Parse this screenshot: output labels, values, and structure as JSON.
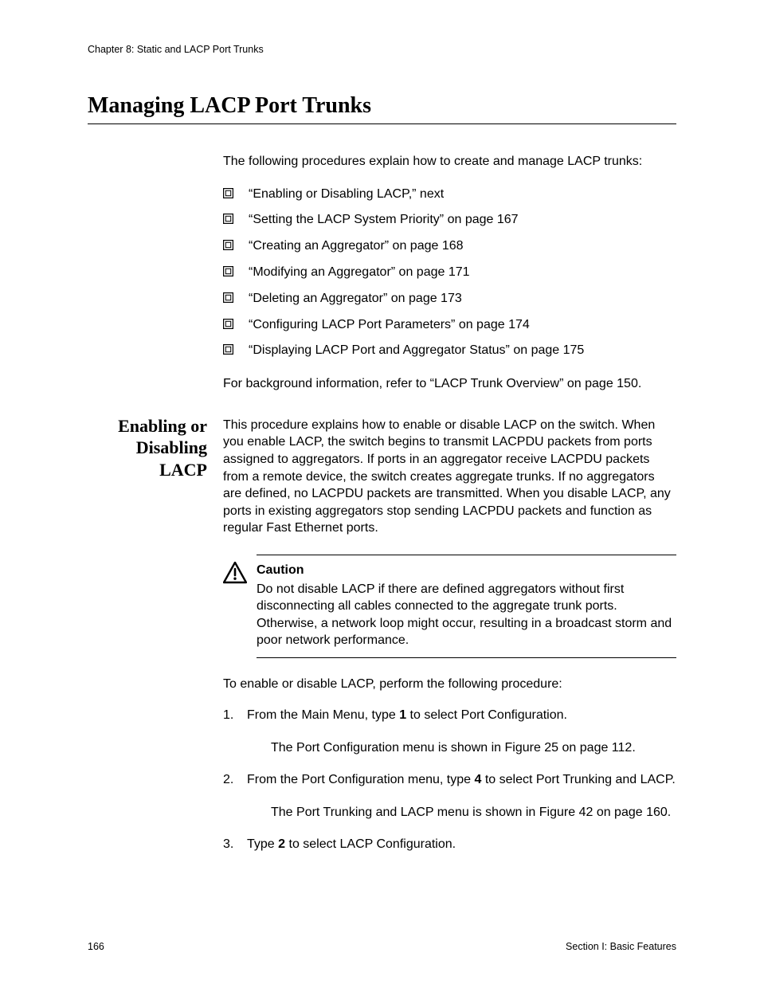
{
  "header": {
    "running": "Chapter 8: Static and LACP Port Trunks"
  },
  "title": "Managing LACP Port Trunks",
  "intro": "The following procedures explain how to create and manage LACP trunks:",
  "bullets": [
    "“Enabling or Disabling LACP,”  next",
    "“Setting the LACP System Priority” on page 167",
    "“Creating an Aggregator” on page 168",
    "“Modifying an Aggregator” on page 171",
    "“Deleting an Aggregator” on page 173",
    "“Configuring LACP Port Parameters” on page 174",
    "“Displaying LACP Port and Aggregator Status” on page 175"
  ],
  "background_ref": "For background information, refer to “LACP Trunk Overview” on page 150.",
  "subsection": {
    "heading_line1": "Enabling or",
    "heading_line2": "Disabling LACP",
    "body": "This procedure explains how to enable or disable LACP on the switch. When you enable LACP, the switch begins to transmit LACPDU packets from ports assigned to aggregators. If ports in an aggregator receive LACPDU packets from a remote device, the switch creates aggregate trunks. If no aggregators are defined, no LACPDU packets are transmitted. When you disable LACP, any ports in existing aggregators stop sending LACPDU packets and function as regular Fast Ethernet ports.",
    "caution": {
      "title": "Caution",
      "text": "Do not disable LACP if there are defined aggregators without first disconnecting all cables connected to the aggregate trunk ports. Otherwise, a network loop might occur, resulting in a broadcast storm and poor network performance."
    },
    "lead": "To enable or disable LACP, perform the following procedure:",
    "steps": [
      {
        "pre": "From the Main Menu, type ",
        "bold": "1",
        "post": " to select Port Configuration.",
        "note": "The Port Configuration menu is shown in Figure 25 on page 112."
      },
      {
        "pre": "From the Port Configuration menu, type ",
        "bold": "4",
        "post": " to select Port Trunking and LACP.",
        "note": "The Port Trunking and LACP menu is shown in Figure 42 on page 160."
      },
      {
        "pre": "Type ",
        "bold": "2",
        "post": " to select LACP Configuration.",
        "note": ""
      }
    ]
  },
  "footer": {
    "page": "166",
    "section": "Section I: Basic Features"
  }
}
